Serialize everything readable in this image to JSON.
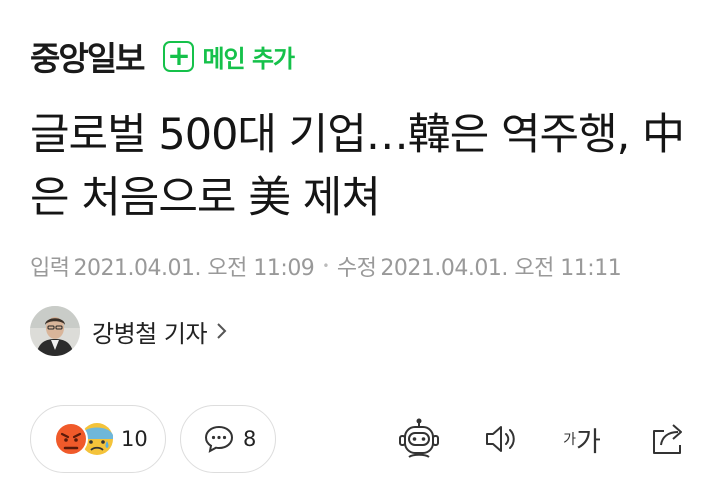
{
  "header": {
    "press_name": "중앙일보",
    "add_main_icon": "plus-icon",
    "add_main_label": "메인 추가",
    "accent_color": "#15c14a"
  },
  "article": {
    "title": "글로벌 500대 기업…韓은 역주행, 中은 처음으로 美 제쳐",
    "input_label": "입력",
    "input_date": "2021.04.01. 오전 11:09",
    "modified_label": "수정",
    "modified_date": "2021.04.01. 오전 11:11"
  },
  "reporter": {
    "name": "강병철 기자",
    "avatar_icon": "reporter-photo",
    "chevron_icon": "chevron-right-icon"
  },
  "actions": {
    "reaction_icons": [
      "angry-face-icon",
      "sad-face-icon"
    ],
    "reaction_count": "10",
    "comment_icon": "comment-bubble-icon",
    "comment_count": "8",
    "tools": {
      "summary_bot_icon": "robot-icon",
      "tts_icon": "speaker-icon",
      "font_size_small": "가",
      "font_size_large": "가",
      "share_icon": "share-icon"
    }
  }
}
